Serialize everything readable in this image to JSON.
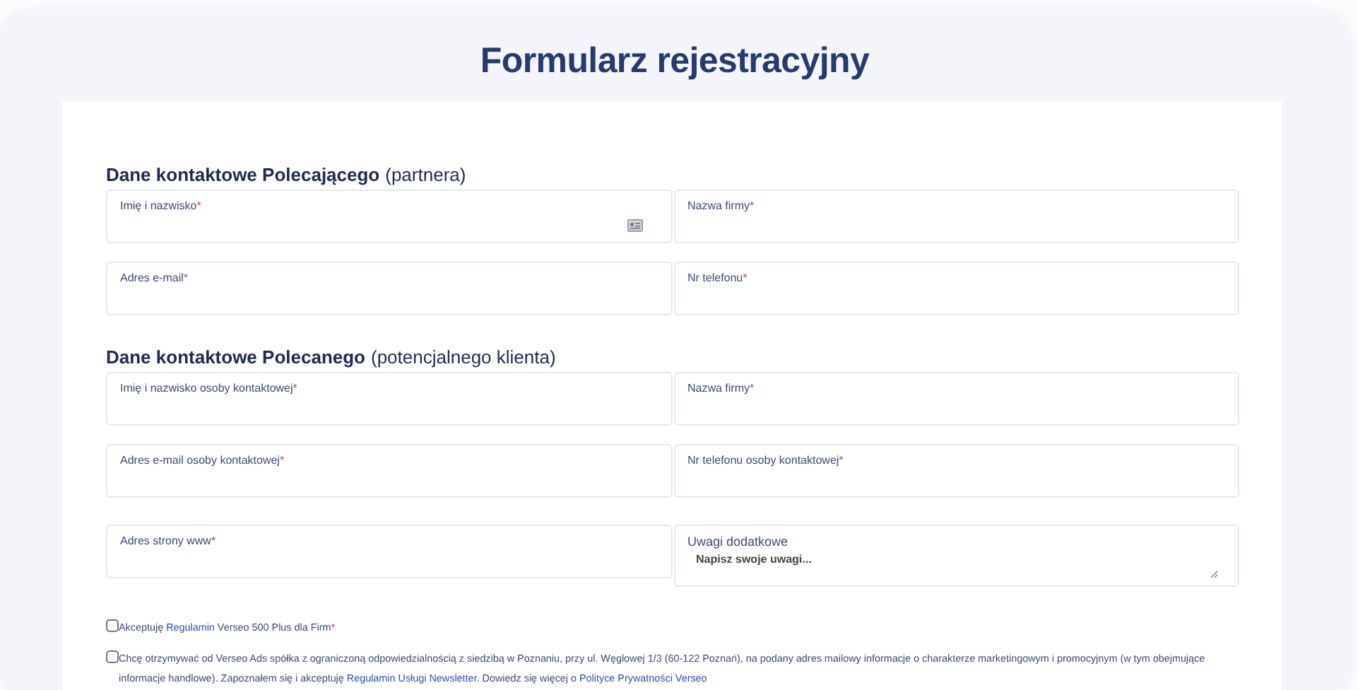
{
  "title": "Formularz rejestracyjny",
  "sections": [
    {
      "heading": "Dane kontaktowe Polecającego",
      "heading_note": "(partnera)",
      "fields": [
        {
          "kind": "input",
          "label": "Imię i nazwisko",
          "required_mark": "*",
          "contact_icon": true
        },
        {
          "kind": "input",
          "label": "Nazwa firmy",
          "required_mark": "*",
          "contact_icon": false
        },
        {
          "kind": "input",
          "label": "Adres e-mail",
          "required_mark": "*",
          "contact_icon": false
        },
        {
          "kind": "input",
          "label": "Nr telefonu",
          "required_mark": "*",
          "contact_icon": false
        }
      ]
    },
    {
      "heading": "Dane kontaktowe Polecanego",
      "heading_note": "(potencjalnego klienta)",
      "fields": [
        {
          "kind": "input",
          "label": "Imię i nazwisko osoby kontaktowej",
          "required_mark": "*",
          "contact_icon": false
        },
        {
          "kind": "input",
          "label": "Nazwa firmy",
          "required_mark": "*",
          "contact_icon": false
        },
        {
          "kind": "input",
          "label": "Adres e-mail osoby kontaktowej",
          "required_mark": "*",
          "contact_icon": false
        },
        {
          "kind": "input",
          "label": "Nr telefonu osoby kontaktowej",
          "required_mark": "*",
          "contact_icon": false
        },
        {
          "kind": "input",
          "label": "Adres strony www",
          "required_mark": "*",
          "contact_icon": false
        },
        {
          "kind": "textarea",
          "label": "Uwagi dodatkowe",
          "placeholder": "Napisz swoje uwagi..."
        }
      ]
    }
  ],
  "consents": [
    {
      "checked": false,
      "parts": [
        {
          "kind": "text",
          "text": "Akceptuję "
        },
        {
          "kind": "link",
          "text": "Regulamin"
        },
        {
          "kind": "text",
          "text": " Verseo 500 Plus dla Firm"
        },
        {
          "kind": "required",
          "text": "*"
        }
      ]
    },
    {
      "checked": false,
      "parts": [
        {
          "kind": "text",
          "text": "Chcę otrzymywać od Verseo Ads spółka z ograniczoną odpowiedzialnością z siedzibą w Poznaniu, przy ul. Węglowej 1/3 (60-122 Poznań), na podany adres mailowy informacje o charakterze marketingowym i promocyjnym (w tym obejmujące informacje handlowe). Zapoznałem się i akceptuję "
        },
        {
          "kind": "link",
          "text": "Regulamin Usługi Newsletter"
        },
        {
          "kind": "text",
          "text": ".  Dowiedz się więcej o "
        },
        {
          "kind": "link",
          "text": "Polityce Prywatności Verseo"
        }
      ]
    }
  ]
}
